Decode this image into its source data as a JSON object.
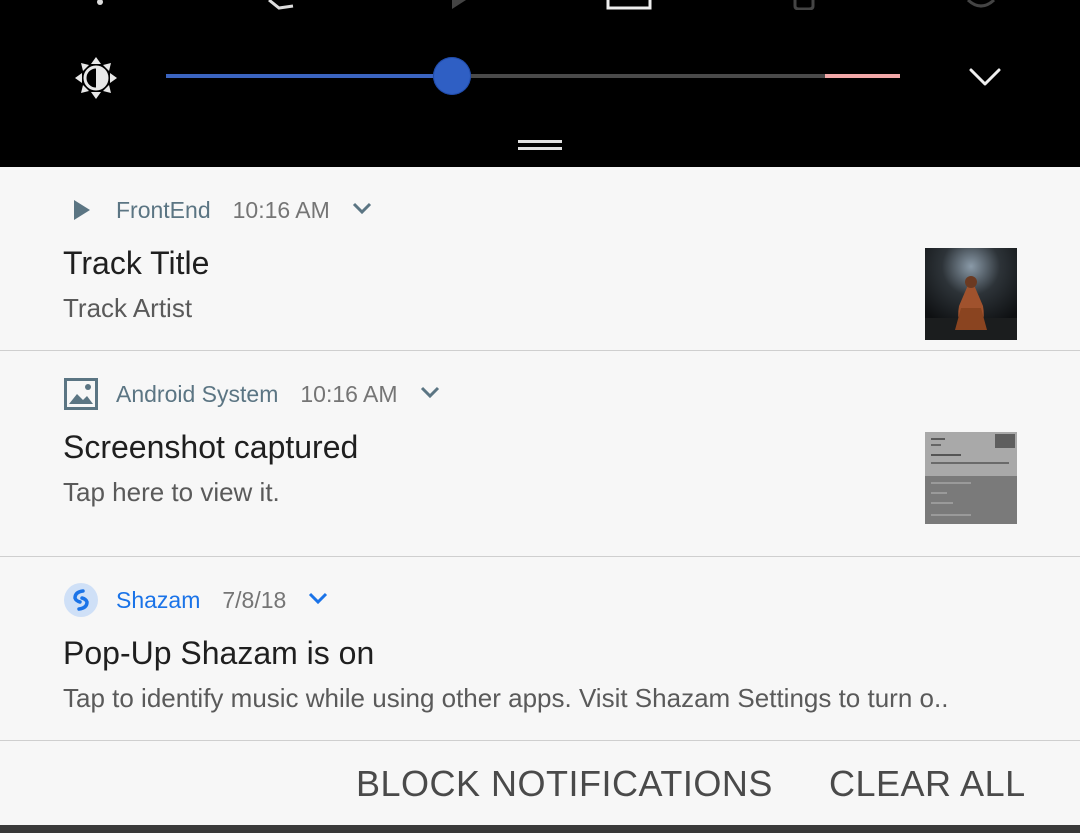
{
  "quick_settings": {
    "brightness_level": 0.39,
    "icons": [
      "brightness-icon",
      "chevron-down-icon"
    ]
  },
  "notifications": [
    {
      "app": "FrontEnd",
      "time": "10:16 AM",
      "icon": "play-icon",
      "title": "Track Title",
      "text": "Track Artist"
    },
    {
      "app": "Android System",
      "time": "10:16 AM",
      "icon": "image-icon",
      "title": "Screenshot captured",
      "text": "Tap here to view it."
    },
    {
      "app": "Shazam",
      "time": "7/8/18",
      "icon": "shazam-icon",
      "title": "Pop-Up Shazam is on",
      "text": "Tap to identify music while using other apps. Visit Shazam Settings to turn o.."
    }
  ],
  "footer": {
    "block_label": "BLOCK NOTIFICATIONS",
    "clear_label": "CLEAR ALL"
  },
  "colors": {
    "accent": "#3b64c0",
    "shazam": "#1a73e8",
    "app_name": "#5b7583"
  }
}
